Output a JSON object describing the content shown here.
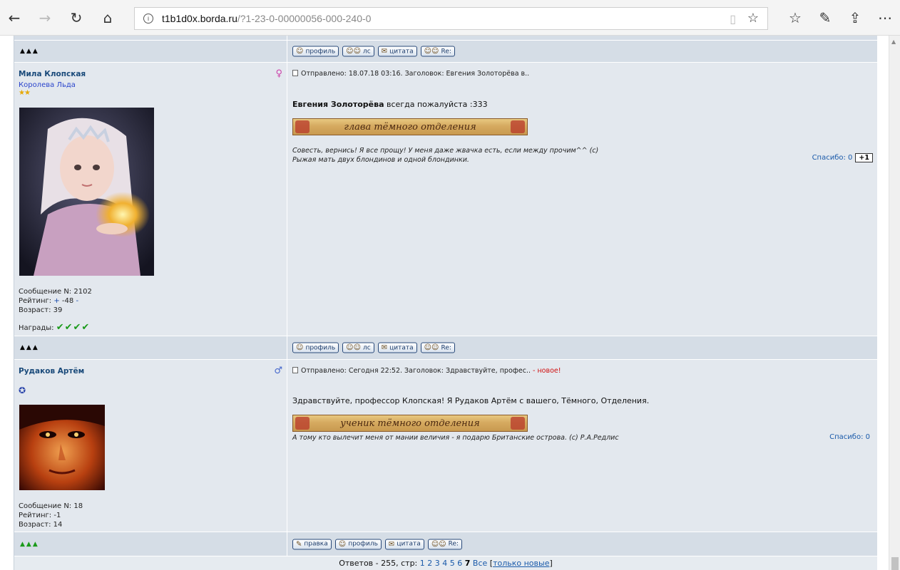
{
  "browser": {
    "url_host": "t1b1d0x.borda.ru",
    "url_path": "/?1-23-0-00000056-000-240-0"
  },
  "buttons": {
    "profile": "профиль",
    "pm": "лс",
    "quote": "цитата",
    "reply": "Re:",
    "edit": "правка"
  },
  "arrows": "▲▲▲",
  "post1": {
    "username": "Мила Клопская",
    "rank": "Королева Льда",
    "stars": "★★",
    "meta": "Отправлено: 18.07.18 03:16. Заголовок: Евгения Золоторёва в..",
    "text_bold": "Евгения Золоторёва",
    "text_rest": " всегда пожалуйста :333",
    "banner": "глава тёмного отделения",
    "signature_line1": "Совесть, вернись! Я все прощу! У меня даже жвачка есть, если между прочим^^ (с)",
    "signature_line2": "Рыжая мать двух блондинов и одной блондинки.",
    "thanks": "Спасибо: 0",
    "plus_one": "+1",
    "msg_no": "Сообщение N: 2102",
    "rating_label": "Рейтинг: ",
    "rating_plus": "+",
    "rating_value": " -48 ",
    "rating_minus": "-",
    "age": "Возраст: 39",
    "awards_label": "Награды: ",
    "awards_icons": "✔✔✔✔"
  },
  "post2": {
    "username": "Рудаков Артём",
    "stars": "✪",
    "meta": "Отправлено: Сегодня 22:52. Заголовок: Здравствуйте, профес..",
    "meta_new": " - новое!",
    "text": "Здравствуйте, профессор Клопская! Я Рудаков Артём с вашего, Тёмного, Отделения.",
    "banner": "ученик тёмного отделения",
    "signature": "А тому кто вылечит меня от мании величия - я подарю Британские острова. (с) Р.А.Редлис",
    "thanks": "Спасибо: 0",
    "msg_no": "Сообщение N: 18",
    "rating": "Рейтинг: -1",
    "age": "Возраст: 14"
  },
  "footer": {
    "label": "Ответов - 255, стр: ",
    "pages": [
      "1",
      "2",
      "3",
      "4",
      "5",
      "6"
    ],
    "current": "7",
    "all": "Все",
    "only_new": "только новые"
  }
}
